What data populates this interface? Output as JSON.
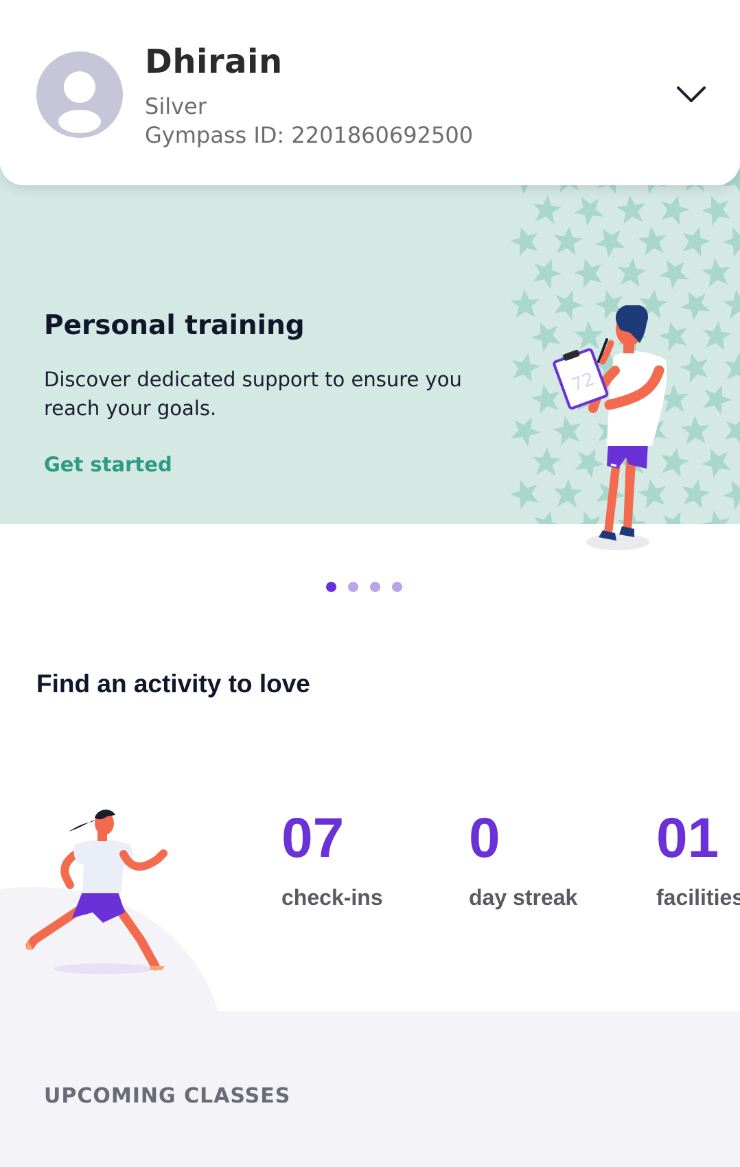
{
  "profile": {
    "name": "Dhirain",
    "plan": "Silver",
    "gympass_id": "Gympass ID: 2201860692500",
    "avatar_icon": "user-silhouette-icon",
    "expand_icon": "chevron-down-icon"
  },
  "banner": {
    "title": "Personal training",
    "text": "Discover dedicated support to ensure you reach your goals.",
    "cta": "Get started",
    "clipboard_number": "72",
    "background_color": "#d4e9e4",
    "cta_color": "#2e9a82"
  },
  "carousel": {
    "total": 4,
    "active_index": 0
  },
  "activity": {
    "title": "Find an activity to love"
  },
  "stats": [
    {
      "value": "07",
      "label": "check-ins"
    },
    {
      "value": "0",
      "label": "day streak"
    },
    {
      "value": "01",
      "label": "facilities"
    }
  ],
  "upcoming": {
    "title": "UPCOMING CLASSES"
  },
  "colors": {
    "accent": "#6a32d6",
    "text_dark": "#10162b",
    "muted": "#6c6c72"
  }
}
